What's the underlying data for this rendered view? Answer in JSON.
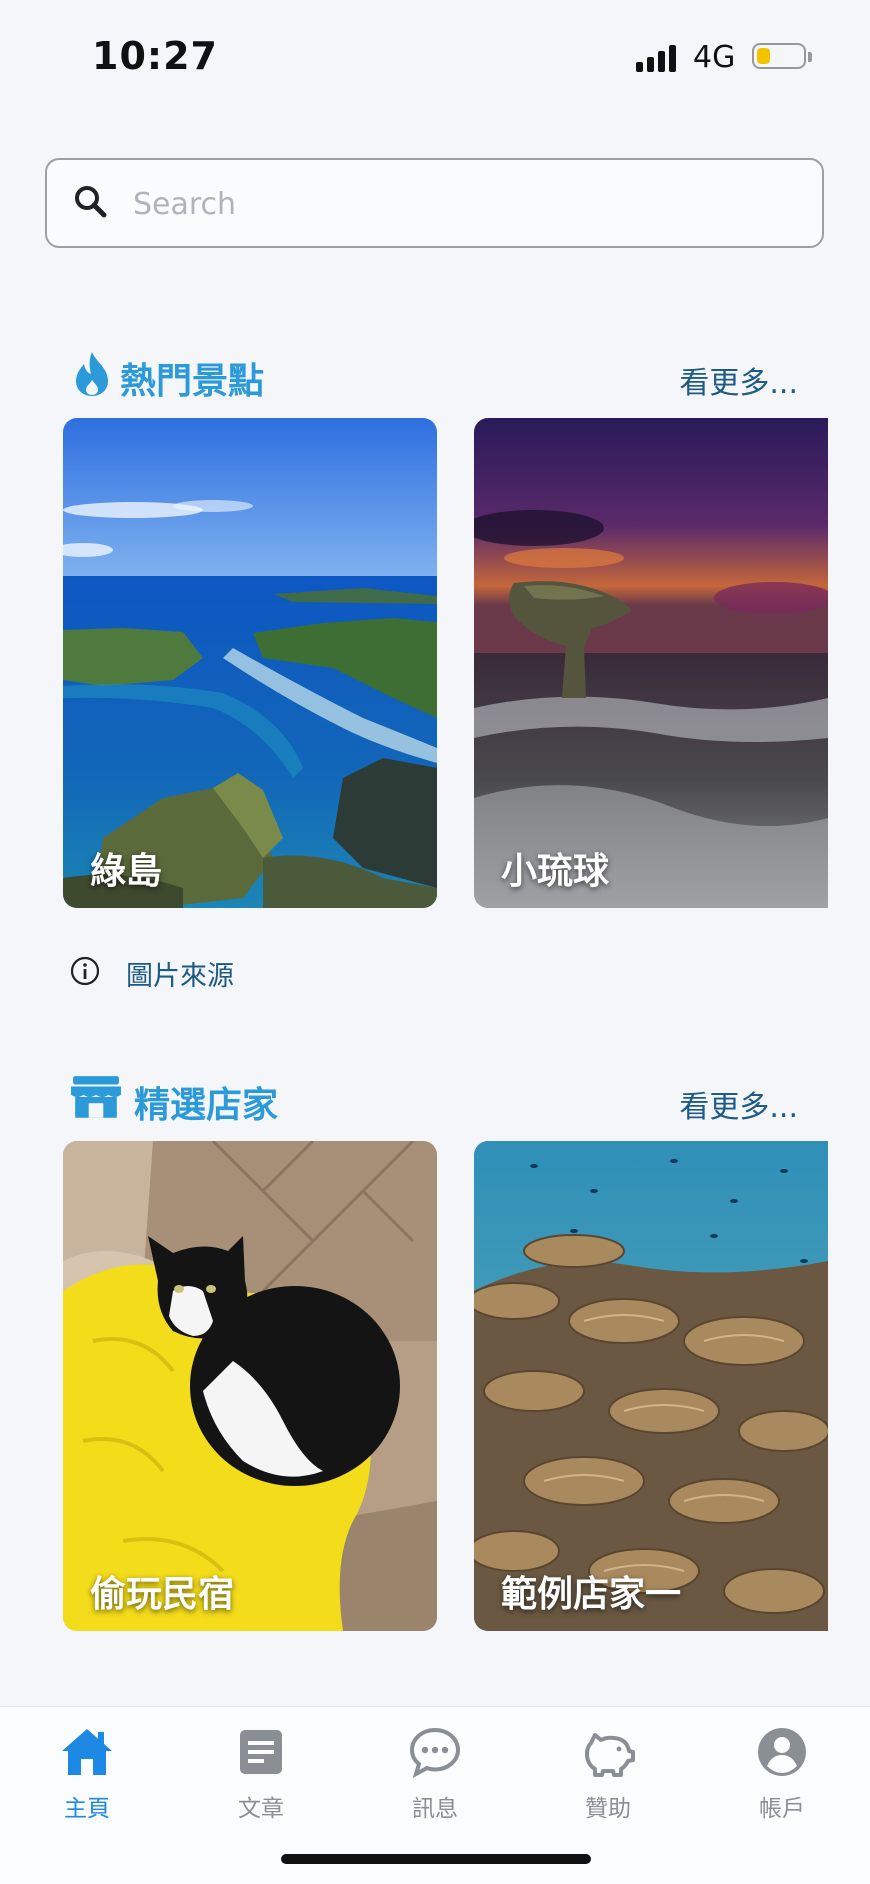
{
  "status_bar": {
    "time": "10:27",
    "network": "4G",
    "battery_level": 0.3
  },
  "search": {
    "placeholder": "Search",
    "value": ""
  },
  "popular": {
    "title": "熱門景點",
    "icon": "flame-icon",
    "see_more": "看更多...",
    "cards": [
      {
        "label": "綠島"
      },
      {
        "label": "小琉球"
      }
    ]
  },
  "image_credit": {
    "text": "圖片來源",
    "icon": "info-icon"
  },
  "featured": {
    "title": "精選店家",
    "icon": "store-icon",
    "see_more": "看更多...",
    "cards": [
      {
        "label": "偷玩民宿"
      },
      {
        "label": "範例店家一"
      }
    ]
  },
  "tabs": [
    {
      "label": "主頁",
      "icon": "home-icon",
      "active": true
    },
    {
      "label": "文章",
      "icon": "article-icon",
      "active": false
    },
    {
      "label": "訊息",
      "icon": "chat-icon",
      "active": false
    },
    {
      "label": "贊助",
      "icon": "piggy-bank-icon",
      "active": false
    },
    {
      "label": "帳戶",
      "icon": "account-icon",
      "active": false
    }
  ],
  "colors": {
    "accent": "#2c9ad8",
    "link": "#1d5a86",
    "tab_active": "#1e88e5",
    "tab_inactive": "#8a8f96"
  }
}
